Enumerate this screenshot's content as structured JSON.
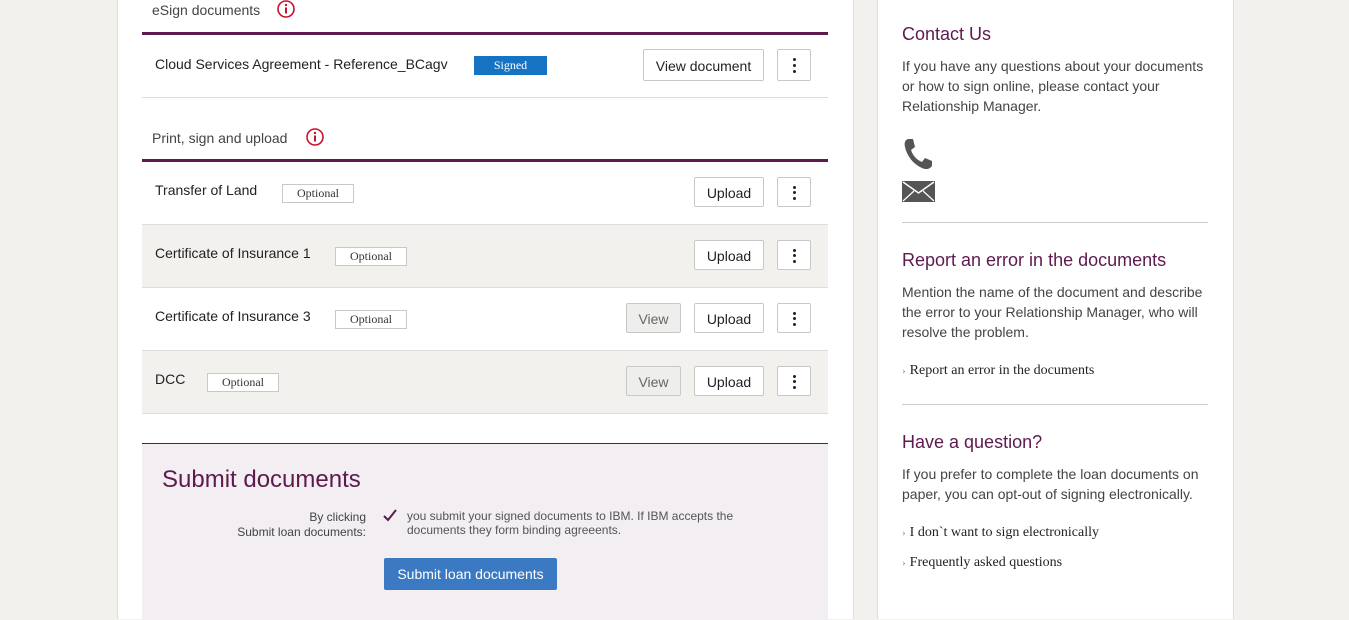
{
  "esign": {
    "heading": "eSign documents",
    "documents": [
      {
        "name": "Cloud Services Agreement - Reference_BCagv",
        "status": "Signed",
        "action": "View document"
      }
    ]
  },
  "print_sign": {
    "heading": "Print, sign and upload",
    "documents": [
      {
        "name": "Transfer of Land",
        "badge": "Optional",
        "upload": "Upload"
      },
      {
        "name": "Certificate of Insurance 1",
        "badge": "Optional",
        "upload": "Upload"
      },
      {
        "name": "Certificate of Insurance 3",
        "badge": "Optional",
        "view": "View",
        "upload": "Upload"
      },
      {
        "name": "DCC",
        "badge": "Optional",
        "view": "View",
        "upload": "Upload"
      }
    ]
  },
  "submit": {
    "title": "Submit documents",
    "label_line1": "By clicking",
    "label_line2": "Submit loan documents:",
    "text": "you submit your signed documents to IBM. If IBM accepts the documents they form binding agreeents.",
    "button": "Submit loan documents"
  },
  "sidebar": {
    "contact": {
      "title": "Contact Us",
      "text": "If you have any questions about your documents or how to sign online, please contact your Relationship Manager.",
      "icons": [
        "phone-icon",
        "envelope-icon"
      ]
    },
    "report": {
      "title": "Report an error in the documents",
      "text": "Mention the name of the document and describe the error to your Relationship Manager, who will resolve the problem.",
      "link": "Report an error in the documents"
    },
    "question": {
      "title": "Have a question?",
      "text": "If you prefer to complete the loan documents on paper, you can opt-out of signing electronically.",
      "links": [
        "I don`t want to sign electronically",
        "Frequently asked questions"
      ]
    }
  },
  "colors": {
    "accent": "#5e1a4e",
    "signed_badge": "#1673c4",
    "primary_button": "#3b79c2",
    "info_icon": "#c8102e"
  }
}
